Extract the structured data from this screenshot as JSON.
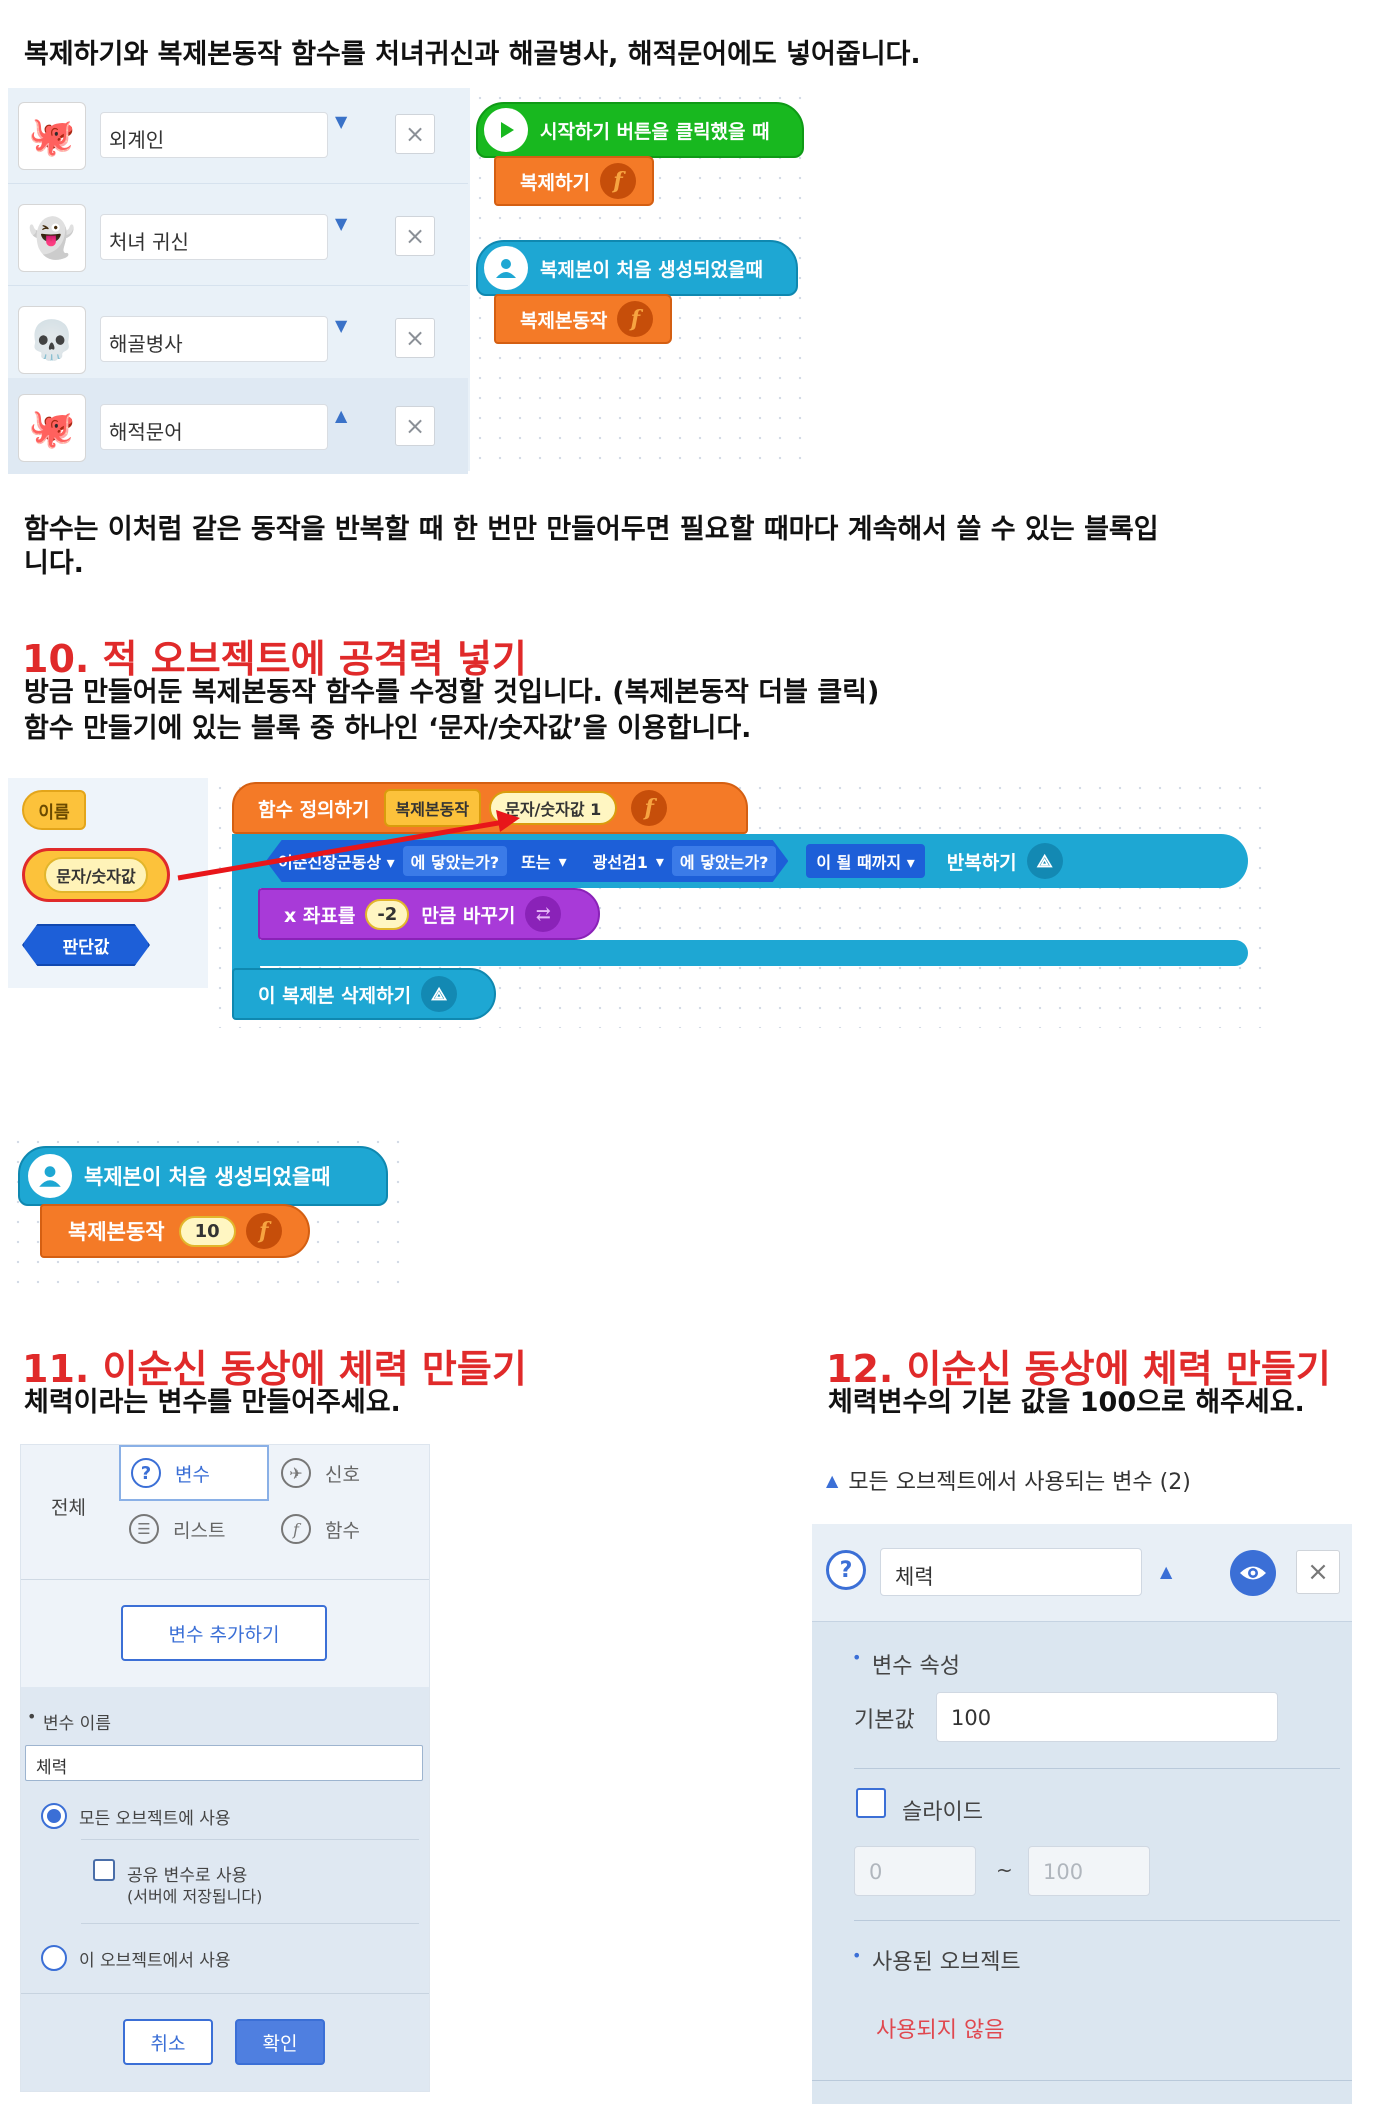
{
  "intro": {
    "text": "복제하기와 복제본동작 함수를 처녀귀신과 해골병사, 해적문어에도 넣어줍니다."
  },
  "object_panel": {
    "objects": [
      {
        "name": "외계인",
        "arrow": "▼",
        "thumb": "🐙"
      },
      {
        "name": "처녀 귀신",
        "arrow": "▼",
        "thumb": "👻"
      },
      {
        "name": "해골병사",
        "arrow": "▼",
        "thumb": "💀"
      },
      {
        "name": "해적문어",
        "arrow": "▲",
        "thumb": "🐙"
      }
    ],
    "delete_symbol": "×"
  },
  "code_blocks_1": {
    "start_hat": "시작하기 버튼을 클릭했을 때",
    "clone_block": "복제하기",
    "clone_hat": "복제본이 처음 생성되었을때",
    "clone_action": "복제본동작",
    "fn_symbol": "f"
  },
  "function_note": {
    "line1": "함수는 이처럼 같은 동작을 반복할 때 한 번만 만들어두면 필요할 때마다 계속해서 쓸 수 있는 블록입",
    "line2": "니다."
  },
  "section10": {
    "heading": "10. 적 오브젝트에 공격력 넣기",
    "line1": "방금 만들어둔 복제본동작 함수를 수정할 것입니다. (복제본동작 더블 클릭)",
    "line2": "함수 만들기에 있는 블록 중 하나인 ‘문자/숫자값’을 이용합니다."
  },
  "param_palette": {
    "name_block": "이름",
    "text_number_block": "문자/숫자값",
    "boolean_block": "판단값"
  },
  "function_def": {
    "define_label": "함수 정의하기",
    "func_name": "복제본동작",
    "param_name": "문자/숫자값 1",
    "loop_target1": "이순신장군동상",
    "touched1": "에 닿았는가?",
    "or_label": "또는",
    "loop_target2": "광선검1",
    "touched2": "에 닿았는가?",
    "until_label": "이 될 때까지",
    "repeat_label": "반복하기",
    "move_x_label": "x 좌표를",
    "move_x_value": "-2",
    "move_x_suffix": "만큼 바꾸기",
    "delete_clone": "이 복제본 삭제하기",
    "dropdown_symbol": "▾"
  },
  "clone_call": {
    "hat": "복제본이 처음 생성되었을때",
    "action": "복제본동작",
    "value": "10"
  },
  "section11": {
    "heading": "11. 이순신 동상에 체력 만들기",
    "subtitle": "체력이라는 변수를 만들어주세요.",
    "tab_all": "전체",
    "tab_variable": "변수",
    "tab_signal": "신호",
    "tab_list": "리스트",
    "tab_function": "함수",
    "add_variable_button": "변수 추가하기",
    "var_name_label": "변수 이름",
    "var_name_value": "체력",
    "option_all_objects": "모든 오브젝트에 사용",
    "option_shared": "공유 변수로 사용",
    "option_shared_note": "(서버에 저장됩니다)",
    "option_this_object": "이 오브젝트에서 사용",
    "cancel_button": "취소",
    "confirm_button": "확인"
  },
  "section12": {
    "heading": "12. 이순신 동상에 체력 만들기",
    "subtitle": "체력변수의 기본 값을 100으로 해주세요.",
    "all_vars_header": "모든 오브젝트에서 사용되는 변수 (2)",
    "var_name": "체력",
    "properties_label": "변수 속성",
    "default_label": "기본값",
    "default_value": "100",
    "slide_label": "슬라이드",
    "slide_min": "0",
    "slide_sep": "~",
    "slide_max": "100",
    "used_objects_label": "사용된 오브젝트",
    "not_used_text": "사용되지 않음"
  },
  "colors": {
    "heading_red": "#e02a2a",
    "block_orange": "#f47a27",
    "block_green": "#18b81f",
    "block_teal": "#1ea7d3",
    "block_blue": "#1d5fd8",
    "accent_blue": "#3b6fd6"
  }
}
